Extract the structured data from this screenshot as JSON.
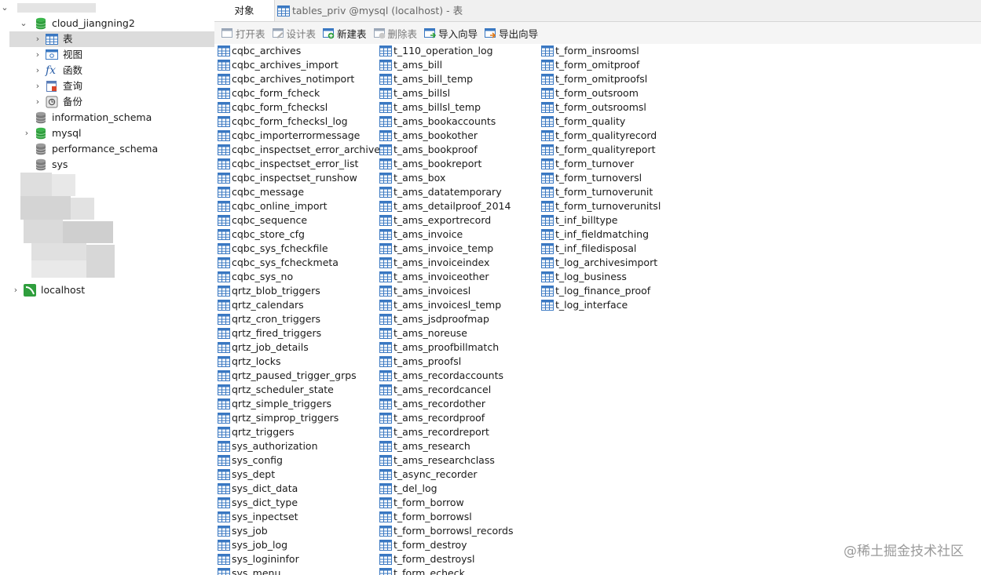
{
  "sidebar": {
    "db_cloud": "cloud_jiangning2",
    "node_tables": "表",
    "node_views": "视图",
    "node_functions": "函数",
    "node_queries": "查询",
    "node_backups": "备份",
    "db_information_schema": "information_schema",
    "db_mysql": "mysql",
    "db_performance_schema": "performance_schema",
    "db_sys": "sys",
    "connection_localhost": "localhost"
  },
  "tabs": {
    "objects": "对象",
    "tables_priv": "tables_priv @mysql (localhost) - 表"
  },
  "toolbar": {
    "open": "打开表",
    "design": "设计表",
    "new": "新建表",
    "delete": "删除表",
    "import": "导入向导",
    "export": "导出向导"
  },
  "colors": {
    "db_green": "#2f9e3d",
    "db_gray": "#8a8a8a",
    "table_blue": "#3a78c2",
    "selection": "#dcdcdc"
  },
  "tables": {
    "col1": [
      "cqbc_archives",
      "cqbc_archives_import",
      "cqbc_archives_notimport",
      "cqbc_form_fcheck",
      "cqbc_form_fchecksl",
      "cqbc_form_fchecksl_log",
      "cqbc_importerrormessage",
      "cqbc_inspectset_error_archives",
      "cqbc_inspectset_error_list",
      "cqbc_inspectset_runshow",
      "cqbc_message",
      "cqbc_online_import",
      "cqbc_sequence",
      "cqbc_store_cfg",
      "cqbc_sys_fcheckfile",
      "cqbc_sys_fcheckmeta",
      "cqbc_sys_no",
      "qrtz_blob_triggers",
      "qrtz_calendars",
      "qrtz_cron_triggers",
      "qrtz_fired_triggers",
      "qrtz_job_details",
      "qrtz_locks",
      "qrtz_paused_trigger_grps",
      "qrtz_scheduler_state",
      "qrtz_simple_triggers",
      "qrtz_simprop_triggers",
      "qrtz_triggers",
      "sys_authorization",
      "sys_config",
      "sys_dept",
      "sys_dict_data",
      "sys_dict_type",
      "sys_inpectset",
      "sys_job",
      "sys_job_log",
      "sys_logininfor",
      "sys_menu"
    ],
    "col2": [
      "t_110_operation_log",
      "t_ams_bill",
      "t_ams_bill_temp",
      "t_ams_billsl",
      "t_ams_billsl_temp",
      "t_ams_bookaccounts",
      "t_ams_bookother",
      "t_ams_bookproof",
      "t_ams_bookreport",
      "t_ams_box",
      "t_ams_datatemporary",
      "t_ams_detailproof_2014",
      "t_ams_exportrecord",
      "t_ams_invoice",
      "t_ams_invoice_temp",
      "t_ams_invoiceindex",
      "t_ams_invoiceother",
      "t_ams_invoicesl",
      "t_ams_invoicesl_temp",
      "t_ams_jsdproofmap",
      "t_ams_noreuse",
      "t_ams_proofbillmatch",
      "t_ams_proofsl",
      "t_ams_recordaccounts",
      "t_ams_recordcancel",
      "t_ams_recordother",
      "t_ams_recordproof",
      "t_ams_recordreport",
      "t_ams_research",
      "t_ams_researchclass",
      "t_async_recorder",
      "t_del_log",
      "t_form_borrow",
      "t_form_borrowsl",
      "t_form_borrowsl_records",
      "t_form_destroy",
      "t_form_destroysl",
      "t_form_echeck"
    ],
    "col3": [
      "t_form_insroomsl",
      "t_form_omitproof",
      "t_form_omitproofsl",
      "t_form_outsroom",
      "t_form_outsroomsl",
      "t_form_quality",
      "t_form_qualityrecord",
      "t_form_qualityreport",
      "t_form_turnover",
      "t_form_turnoversl",
      "t_form_turnoverunit",
      "t_form_turnoverunitsl",
      "t_inf_billtype",
      "t_inf_fieldmatching",
      "t_inf_filedisposal",
      "t_log_archivesimport",
      "t_log_business",
      "t_log_finance_proof",
      "t_log_interface"
    ]
  },
  "watermark": "@稀土掘金技术社区"
}
